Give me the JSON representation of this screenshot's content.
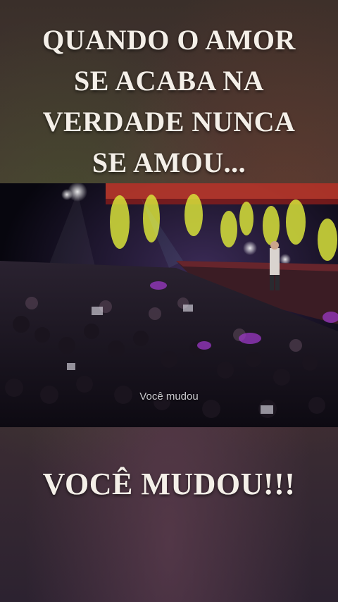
{
  "top_caption": {
    "line1": "QUANDO O AMOR",
    "line2": "SE ACABA NA",
    "line3": "VERDADE NUNCA",
    "line4": "SE AMOU..."
  },
  "video": {
    "subtitle": "Você mudou"
  },
  "bottom_caption": "VOCÊ MUDOU!!!"
}
